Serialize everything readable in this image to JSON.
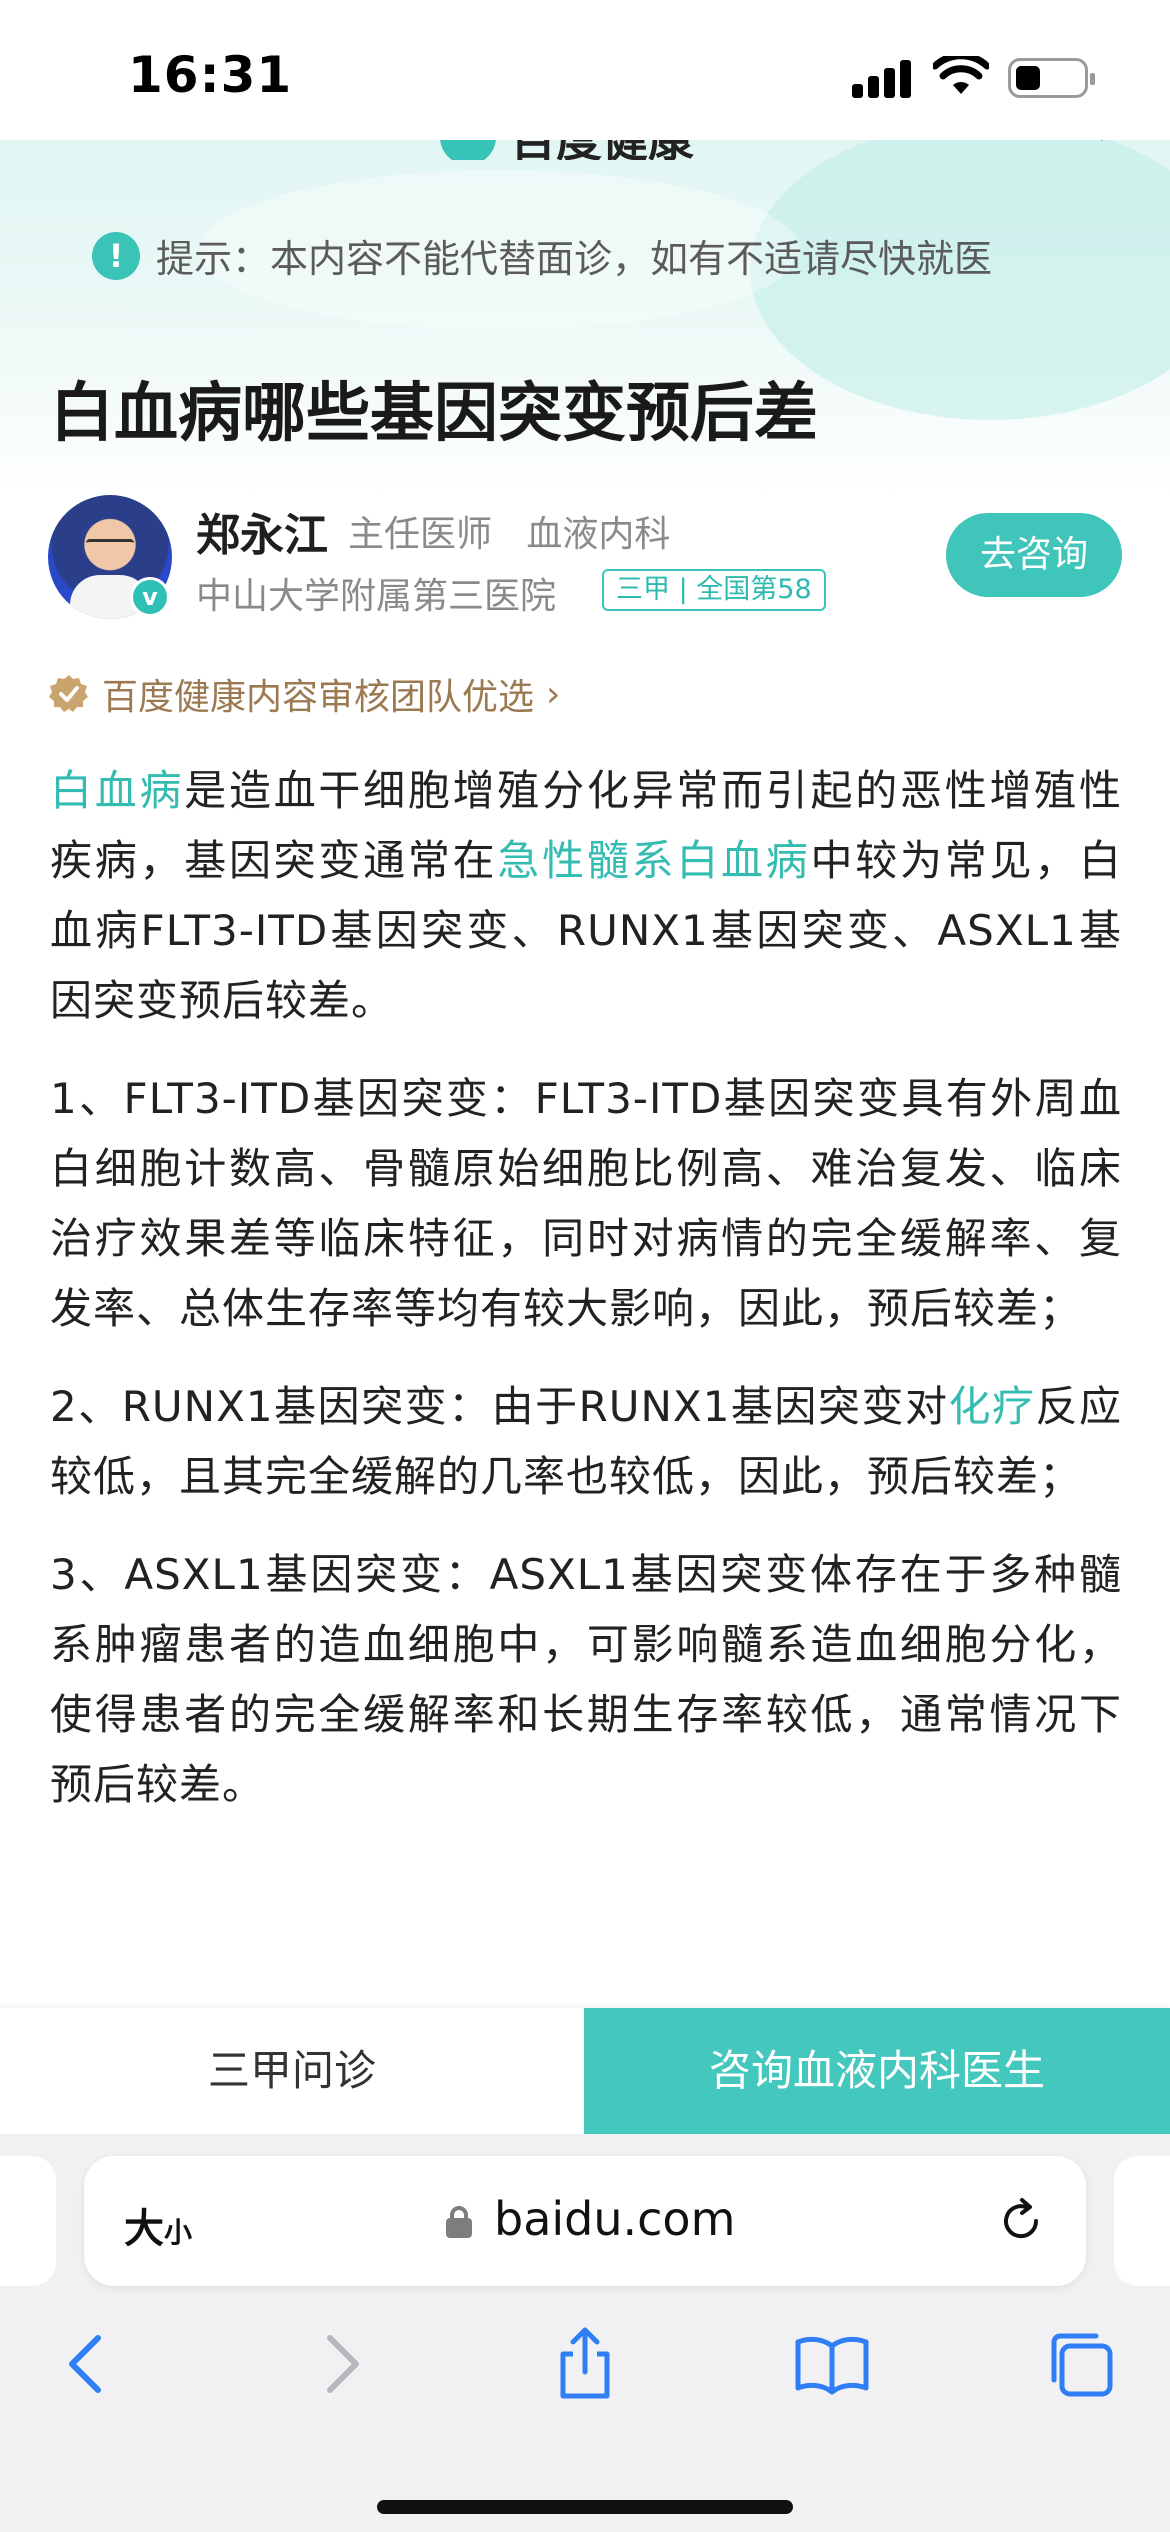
{
  "status_bar": {
    "time": "16:31"
  },
  "brand": {
    "name": "百度健康"
  },
  "notice": {
    "text": "提示：本内容不能代替面诊，如有不适请尽快就医"
  },
  "article": {
    "title": "白血病哪些基因突变预后差",
    "author": {
      "name": "郑永江",
      "title": "主任医师",
      "department": "血液内科",
      "hospital": "中山大学附属第三医院",
      "hospital_badge": "三甲 | 全国第58",
      "consult_label": "去咨询"
    },
    "review_label": "百度健康内容审核团队优选",
    "intro": {
      "link1": "白血病",
      "text1": "是造血干细胞增殖分化异常而引起的恶性增殖性疾病，基因突变通常在",
      "link2": "急性髓系白血病",
      "text2": "中较为常见，白血病FLT3-ITD基因突变、RUNX1基因突变、ASXL1基因突变预后较差。"
    },
    "point1": "1、FLT3-ITD基因突变：FLT3-ITD基因突变具有外周血白细胞计数高、骨髓原始细胞比例高、难治复发、临床治疗效果差等临床特征，同时对病情的完全缓解率、复发率、总体生存率等均有较大影响，因此，预后较差；",
    "point2": {
      "text1": "2、RUNX1基因突变：由于RUNX1基因突变对",
      "link": "化疗",
      "text2": "反应较低，且其完全缓解的几率也较低，因此，预后较差；"
    },
    "point3": "3、ASXL1基因突变：ASXL1基因突变体存在于多种髓系肿瘤患者的造血细胞中，可影响髓系造血细胞分化，使得患者的完全缓解率和长期生存率较低，通常情况下预后较差。"
  },
  "action_bar": {
    "left_label": "三甲问诊",
    "right_label": "咨询血液内科医生"
  },
  "browser": {
    "text_size_label_big": "大",
    "text_size_label_small": "小",
    "domain": "baidu.com"
  },
  "colors": {
    "accent": "#3fc5b9",
    "review_gold": "#9b7a52"
  },
  "icons": [
    "signal-icon",
    "wifi-icon",
    "battery-icon",
    "info-icon",
    "verified-icon",
    "review-badge-icon",
    "lock-icon",
    "reload-icon",
    "back-icon",
    "forward-icon",
    "share-icon",
    "bookmarks-icon",
    "tabs-icon"
  ]
}
